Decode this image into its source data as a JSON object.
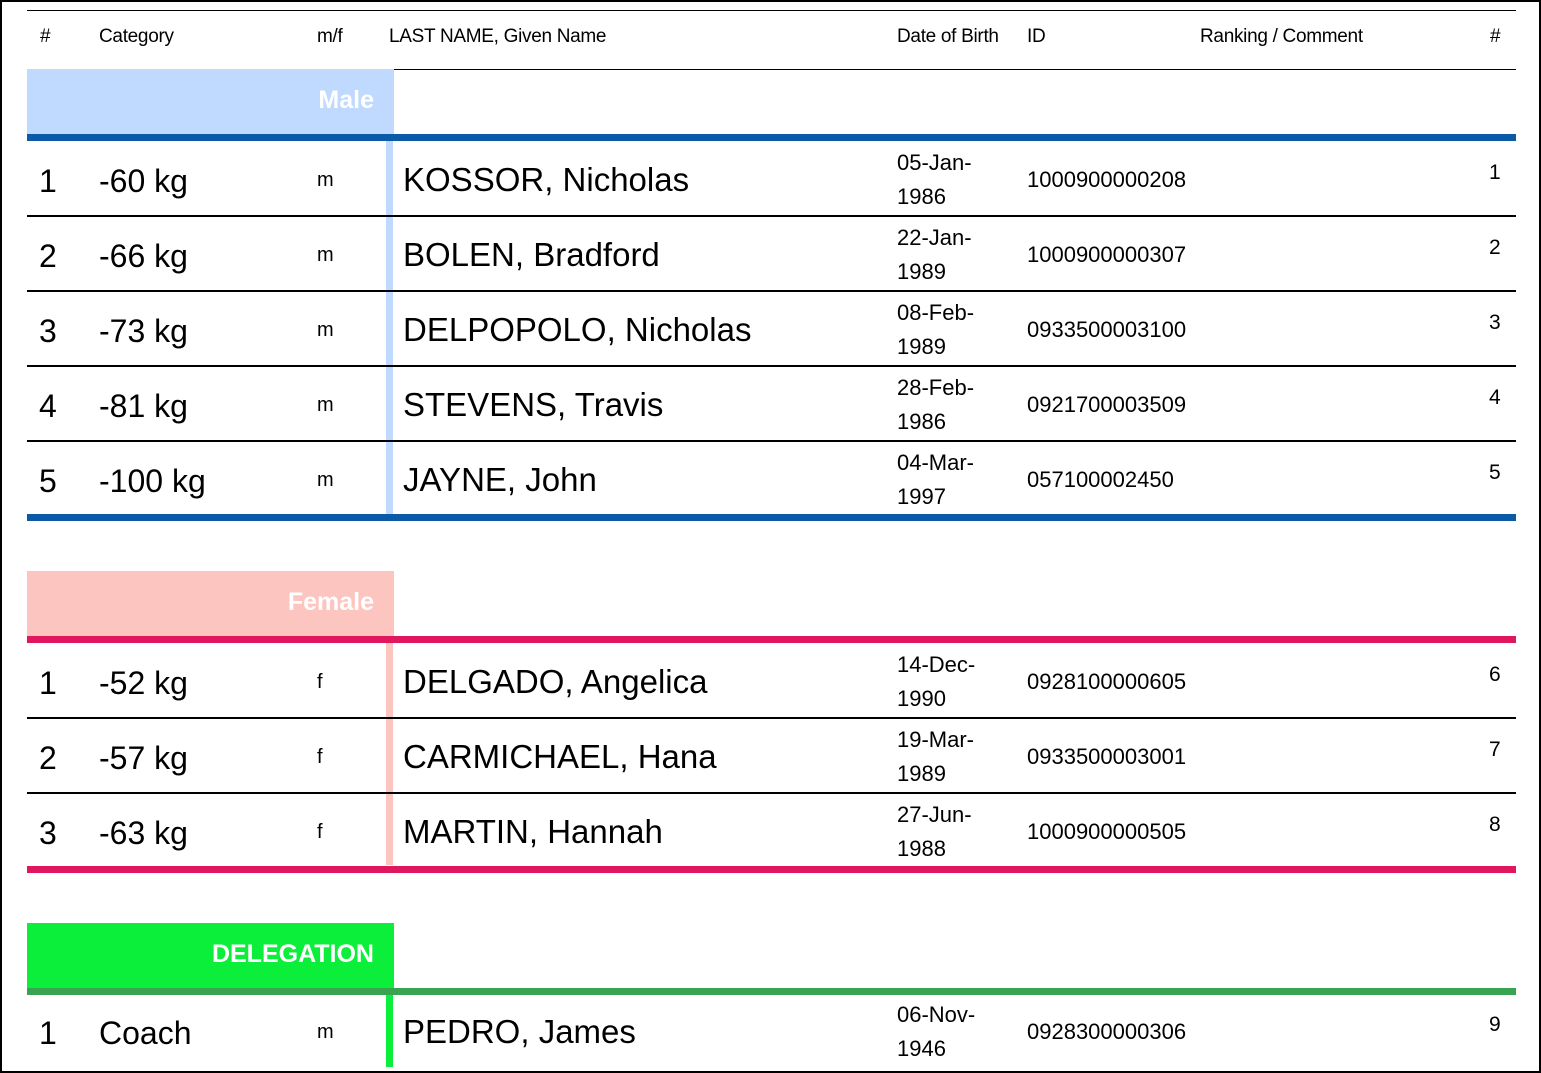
{
  "header": {
    "num": "#",
    "category": "Category",
    "mf": "m/f",
    "name": "LAST NAME, Given Name",
    "dob": "Date of Birth",
    "id": "ID",
    "ranking": "Ranking / Comment",
    "num2": "#"
  },
  "colors": {
    "male_light": "#bfd9ff",
    "male_dark": "#0a5aa8",
    "female_light": "#fcc5c0",
    "female_dark": "#e0175f",
    "deleg_light": "#0bef3a",
    "deleg_dark": "#3aa34f"
  },
  "male": {
    "label": "Male",
    "rows": [
      {
        "num": "1",
        "category": "-60 kg",
        "mf": "m",
        "name": "KOSSOR, Nicholas",
        "dob": "05-Jan-1986",
        "id": "1000900000208",
        "idx": "1"
      },
      {
        "num": "2",
        "category": "-66 kg",
        "mf": "m",
        "name": "BOLEN, Bradford",
        "dob": "22-Jan-1989",
        "id": "1000900000307",
        "idx": "2"
      },
      {
        "num": "3",
        "category": "-73 kg",
        "mf": "m",
        "name": "DELPOPOLO, Nicholas",
        "dob": "08-Feb-1989",
        "id": "0933500003100",
        "idx": "3"
      },
      {
        "num": "4",
        "category": "-81 kg",
        "mf": "m",
        "name": "STEVENS, Travis",
        "dob": "28-Feb-1986",
        "id": "0921700003509",
        "idx": "4"
      },
      {
        "num": "5",
        "category": "-100 kg",
        "mf": "m",
        "name": "JAYNE, John",
        "dob": "04-Mar-1997",
        "id": "057100002450",
        "idx": "5"
      }
    ]
  },
  "female": {
    "label": "Female",
    "rows": [
      {
        "num": "1",
        "category": "-52 kg",
        "mf": "f",
        "name": "DELGADO, Angelica",
        "dob": "14-Dec-1990",
        "id": "0928100000605",
        "idx": "6"
      },
      {
        "num": "2",
        "category": "-57 kg",
        "mf": "f",
        "name": "CARMICHAEL, Hana",
        "dob": "19-Mar-1989",
        "id": "0933500003001",
        "idx": "7"
      },
      {
        "num": "3",
        "category": "-63 kg",
        "mf": "f",
        "name": "MARTIN, Hannah",
        "dob": "27-Jun-1988",
        "id": "1000900000505",
        "idx": "8"
      }
    ]
  },
  "delegation": {
    "label": "DELEGATION",
    "rows": [
      {
        "num": "1",
        "category": "Coach",
        "mf": "m",
        "name": "PEDRO, James",
        "dob": "06-Nov-1946",
        "id": "0928300000306",
        "idx": "9"
      }
    ]
  }
}
